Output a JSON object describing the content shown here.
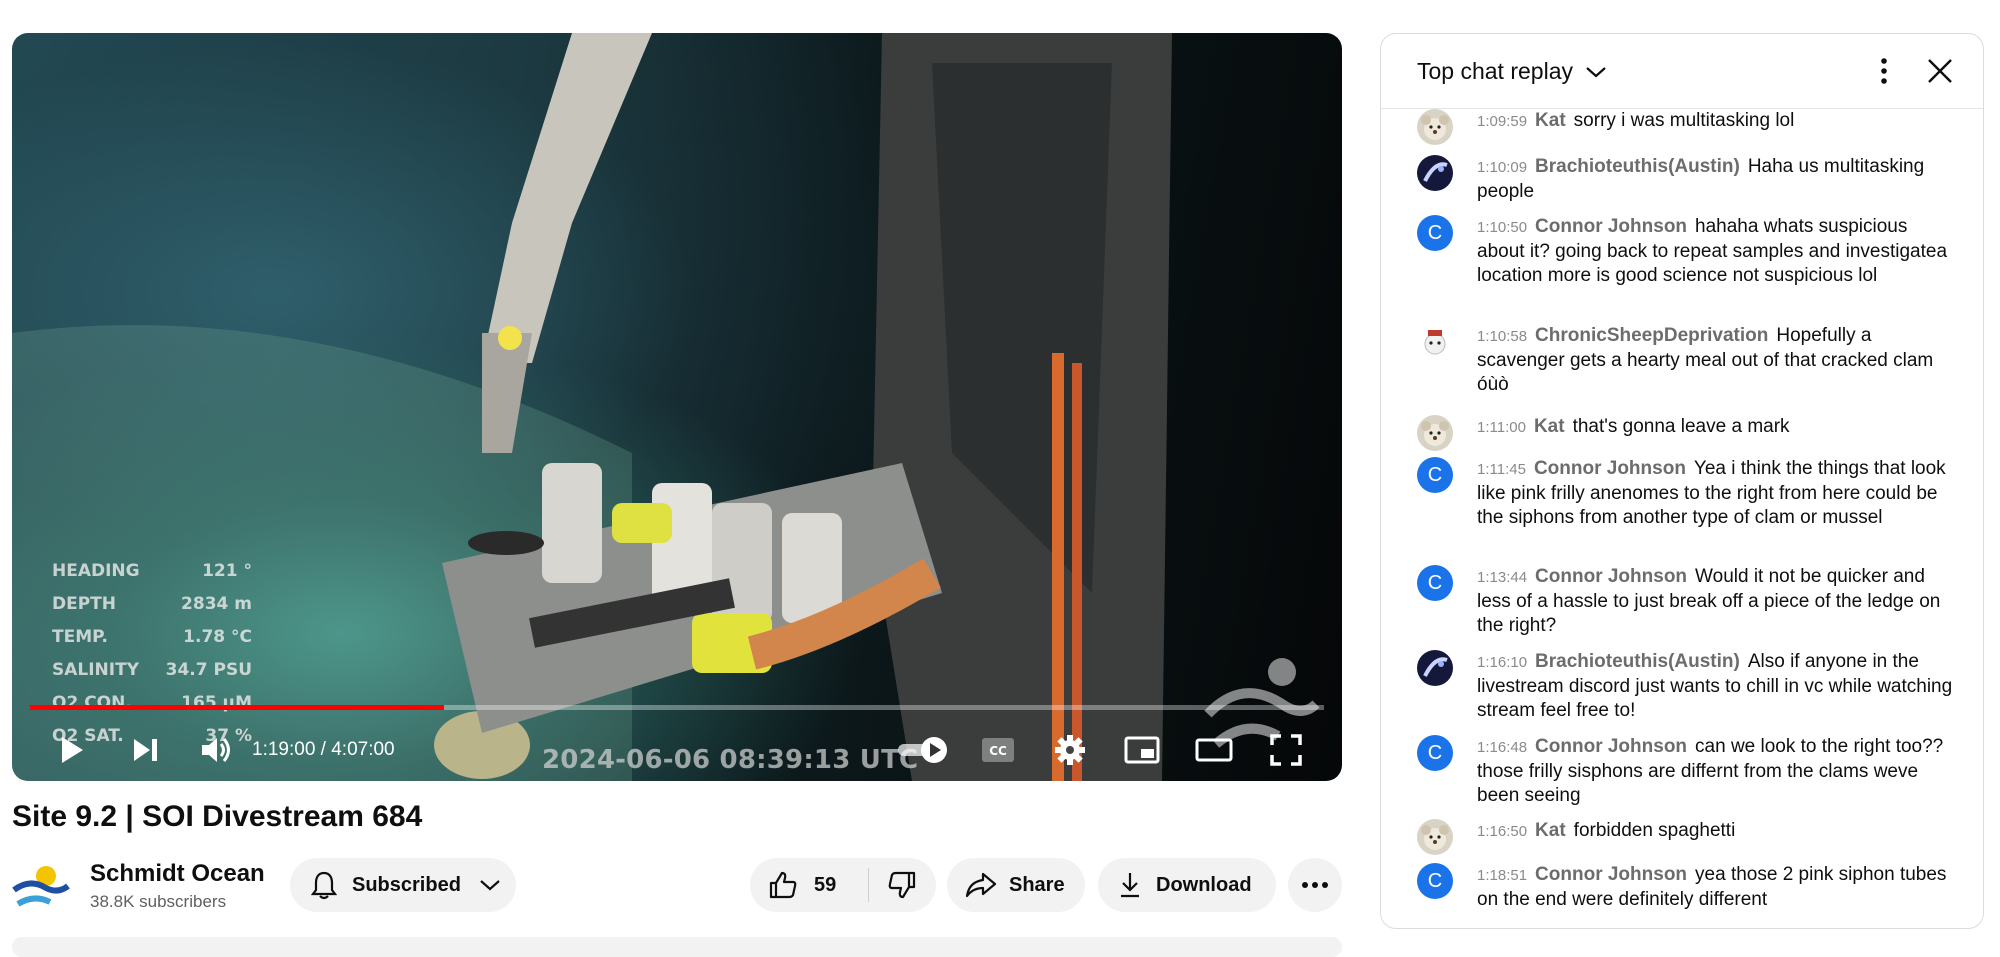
{
  "player": {
    "telemetry": [
      {
        "label": "HEADING",
        "value": "121 °"
      },
      {
        "label": "DEPTH",
        "value": "2834 m"
      },
      {
        "label": "TEMP.",
        "value": "1.78 °C"
      },
      {
        "label": "SALINITY",
        "value": "34.7 PSU"
      },
      {
        "label": "O2 CON.",
        "value": "165 μM"
      },
      {
        "label": "O2 SAT.",
        "value": "37 %"
      }
    ],
    "timestamp": "2024-06-06   08:39:13 UTC",
    "time_display": "1:19:00 / 4:07:00",
    "progress_fraction": 0.32,
    "colors": {
      "progress": "#ff0000"
    }
  },
  "video": {
    "title": "Site 9.2 | SOI Divestream 684",
    "channel_name": "Schmidt Ocean",
    "subscribers": "38.8K subscribers",
    "subscribe_label": "Subscribed",
    "likes": "59",
    "share_label": "Share",
    "download_label": "Download"
  },
  "chat": {
    "title": "Top chat replay",
    "messages": [
      {
        "time": "1:09:59",
        "author": "Kat",
        "text": "sorry i was multitasking lol",
        "avatar": "bear"
      },
      {
        "time": "1:10:09",
        "author": "Brachioteuthis(Austin)",
        "text": "Haha us multitasking people",
        "avatar": "squid"
      },
      {
        "time": "1:10:50",
        "author": "Connor Johnson",
        "text": "hahaha whats suspicious about it? going back to repeat samples and investigatea location more is good science not suspicious lol",
        "avatar": "C"
      },
      {
        "time": "1:10:58",
        "author": "ChronicSheepDeprivation",
        "text": "Hopefully a scavenger gets a hearty meal out of that cracked clam óùò",
        "avatar": "sheep"
      },
      {
        "time": "1:11:00",
        "author": "Kat",
        "text": "that's gonna leave a mark",
        "avatar": "bear"
      },
      {
        "time": "1:11:45",
        "author": "Connor Johnson",
        "text": "Yea i think the things that look like pink frilly anenomes to the right from here could be the siphons from another type of clam or mussel",
        "avatar": "C"
      },
      {
        "time": "1:13:44",
        "author": "Connor Johnson",
        "text": "Would it not be quicker and less of a hassle to just break off a piece of the ledge on the right?",
        "avatar": "C"
      },
      {
        "time": "1:16:10",
        "author": "Brachioteuthis(Austin)",
        "text": "Also if anyone in the livestream discord just wants to chill in vc while watching stream feel free to!",
        "avatar": "squid"
      },
      {
        "time": "1:16:48",
        "author": "Connor Johnson",
        "text": "can we look to the right too?? those frilly sisphons are differnt from the clams weve been seeing",
        "avatar": "C"
      },
      {
        "time": "1:16:50",
        "author": "Kat",
        "text": "forbidden spaghetti",
        "avatar": "bear"
      },
      {
        "time": "1:18:51",
        "author": "Connor Johnson",
        "text": "yea those 2 pink siphon tubes on the end were definitely different",
        "avatar": "C"
      }
    ]
  }
}
